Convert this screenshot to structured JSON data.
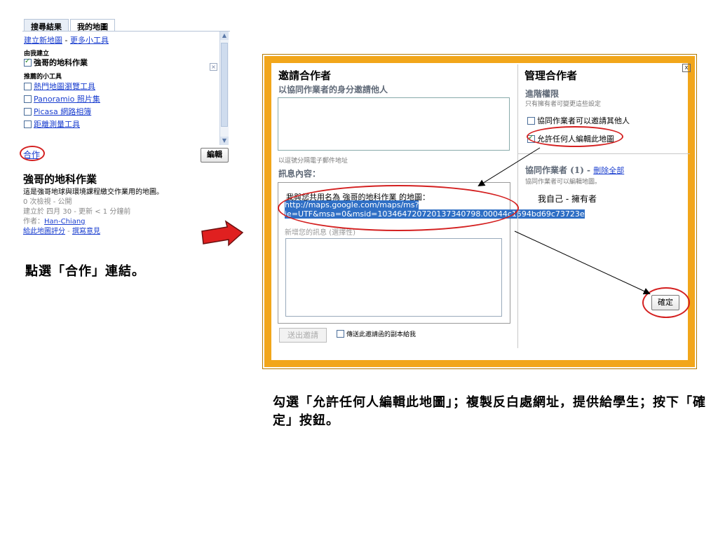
{
  "left_panel": {
    "tabs": [
      "搜尋結果",
      "我的地圖"
    ],
    "create_map": "建立新地圖",
    "separator": " - ",
    "more_tools": "更多小工具",
    "created_by_me": "由我建立",
    "my_map_name": "強哥的地科作業",
    "recommended_tools": "推薦的小工具",
    "tools": [
      "熱門地圖瀏覽工具",
      "Panoramio 照片集",
      "Picasa 網路相簿",
      "距離測量工具"
    ],
    "collaborate_link": "合作",
    "edit_button": "編輯",
    "map_title": "強哥的地科作業",
    "map_desc": "這是強哥地球與環境課程繳交作業用的地圖。",
    "views": "0 次檢視 - 公開",
    "created": "建立於 四月 30 - 更新 < 1 分鐘前",
    "author_label": "作者：",
    "author": "Han-Chiang",
    "rate": "給此地圖評分",
    "review": "撰寫意見"
  },
  "caption_left": "點選「合作」連結。",
  "dialog": {
    "invite_title": "邀請合作者",
    "invite_sub": "以協同作業者的身分邀請他人",
    "email_hint": "以逗號分隔電子郵件地址",
    "message_label": "訊息內容：",
    "message_line": "我與您共用名為 強哥的地科作業 的地圖：",
    "url": "http://maps.google.com/maps/ms?ie=UTF&msa=0&msid=103464720720137340798.00044c1594bd69c73723e",
    "new_msg_hint": "新增您的訊息 (選擇性)",
    "send_button": "送出邀請",
    "copy_option": "傳送此邀請函的副本給我",
    "manage_title": "管理合作者",
    "advanced_label": "進階權限",
    "advanced_hint": "只有擁有者可變更這些設定",
    "opt_invite": "協同作業者可以邀請其他人",
    "opt_edit": "允許任何人編輯此地圖",
    "collab_label": "協同作業者 (1) - ",
    "delete_all": "刪除全部",
    "collab_hint": "協同作業者可以編輯地圖。",
    "me_owner": "我自己 - 擁有者",
    "ok_button": "確定",
    "close_icon": "x"
  },
  "caption_right": "勾選「允許任何人編輯此地圖」；複製反白處網址，提供給學生；按下「確定」按鈕。",
  "colors": {
    "dialog_border": "#f2a61a",
    "annotation_red": "#d42020",
    "selection_blue": "#2f6fc5",
    "link_blue": "#1a3ecf"
  }
}
